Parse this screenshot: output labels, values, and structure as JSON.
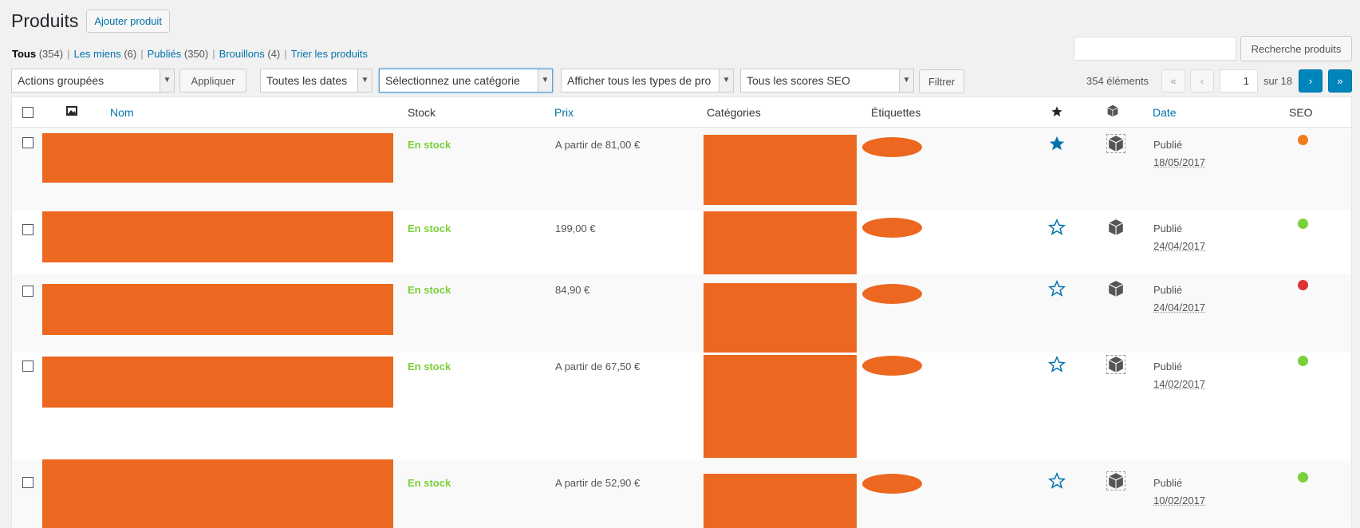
{
  "header": {
    "title": "Produits",
    "add_button": "Ajouter produit"
  },
  "filters_nav": {
    "all": {
      "label": "Tous",
      "count": "(354)"
    },
    "mine": {
      "label": "Les miens",
      "count": "(6)"
    },
    "published": {
      "label": "Publiés",
      "count": "(350)"
    },
    "drafts": {
      "label": "Brouillons",
      "count": "(4)"
    },
    "sort": {
      "label": "Trier les produits"
    },
    "separator": "|"
  },
  "search": {
    "value": "",
    "button": "Recherche produits"
  },
  "toolbar": {
    "bulk_actions": "Actions groupées",
    "apply": "Appliquer",
    "dates": "Toutes les dates",
    "category": "Sélectionnez une catégorie",
    "product_type": "Afficher tous les types de pro",
    "seo_scores": "Tous les scores SEO",
    "filter": "Filtrer"
  },
  "pagination": {
    "items_count": "354 éléments",
    "first": "«",
    "prev": "‹",
    "current_page": "1",
    "total": "sur 18",
    "next": "›",
    "last": "»"
  },
  "columns": {
    "name": "Nom",
    "stock": "Stock",
    "price": "Prix",
    "categories": "Catégories",
    "tags": "Étiquettes",
    "date": "Date",
    "seo": "SEO"
  },
  "colors": {
    "accent": "#0073aa",
    "redacted": "#ec671f",
    "stock": "#7ad03a",
    "seo_orange": "#ee7c1b",
    "seo_green": "#7ad03a",
    "seo_red": "#dc3232"
  },
  "products": [
    {
      "stock": "En stock",
      "price": "A partir de 81,00 €",
      "featured": true,
      "status": "Publié",
      "date": "18/05/2017",
      "seo": "orange"
    },
    {
      "stock": "En stock",
      "price": "199,00 €",
      "featured": false,
      "status": "Publié",
      "date": "24/04/2017",
      "seo": "green"
    },
    {
      "stock": "En stock",
      "price": "84,90 €",
      "featured": false,
      "status": "Publié",
      "date": "24/04/2017",
      "seo": "red"
    },
    {
      "stock": "En stock",
      "price": "A partir de 67,50 €",
      "featured": false,
      "status": "Publié",
      "date": "14/02/2017",
      "seo": "green"
    },
    {
      "stock": "En stock",
      "price": "A partir de 52,90 €",
      "featured": false,
      "status": "Publié",
      "date": "10/02/2017",
      "seo": "green"
    }
  ]
}
